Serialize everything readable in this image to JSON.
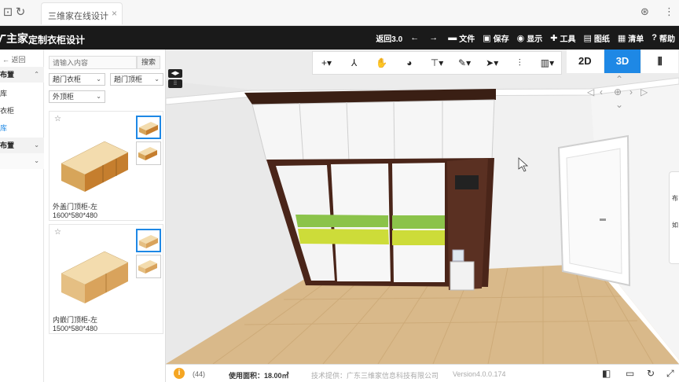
{
  "browser": {
    "tab_title": "三维家在线设计",
    "close_glyph": "×",
    "back_icon": "refresh-icon",
    "right_icons": [
      "extension-icon",
      "menu-icon"
    ]
  },
  "app": {
    "logo_text": "主家",
    "title": "定制衣柜设计",
    "menu": [
      {
        "icon": "undo-icon",
        "glyph": "",
        "label": "返回3.0"
      },
      {
        "icon": "arrow-left-icon",
        "glyph": "←",
        "label": ""
      },
      {
        "icon": "arrow-right-icon",
        "glyph": "→",
        "label": ""
      },
      {
        "icon": "folder-icon",
        "glyph": "▬",
        "label": "文件"
      },
      {
        "icon": "save-icon",
        "glyph": "▣",
        "label": "保存"
      },
      {
        "icon": "display-icon",
        "glyph": "◉",
        "label": "显示"
      },
      {
        "icon": "tools-icon",
        "glyph": "✚",
        "label": "工具"
      },
      {
        "icon": "drawings-icon",
        "glyph": "▤",
        "label": "图纸"
      },
      {
        "icon": "list-icon",
        "glyph": "▦",
        "label": "清单"
      },
      {
        "icon": "help-icon",
        "glyph": "?",
        "label": "帮助"
      }
    ]
  },
  "left_nav": {
    "back_label": "返回",
    "rows": [
      {
        "label": "布置",
        "type": "group",
        "chev": "⌃"
      },
      {
        "label": "库",
        "type": "item"
      },
      {
        "label": "衣柜",
        "type": "item"
      },
      {
        "label": "库",
        "type": "active"
      },
      {
        "label": "布置",
        "type": "group",
        "chev": "⌄"
      },
      {
        "label": "",
        "type": "group-light",
        "chev": "⌄"
      }
    ]
  },
  "catalog": {
    "search_placeholder": "请输入内容",
    "search_button": "搜索",
    "filters": [
      "趟门衣柜",
      "趟门顶柜",
      "外顶柜"
    ],
    "items": [
      {
        "name": "外盖门顶柜-左",
        "size": "1600*580*480"
      },
      {
        "name": "内嵌门顶柜-左",
        "size": "1500*580*480"
      }
    ]
  },
  "toolbar": {
    "tools": [
      {
        "name": "add-icon",
        "glyph": "+▾"
      },
      {
        "name": "pen-icon",
        "glyph": "⅄"
      },
      {
        "name": "hand-icon",
        "glyph": "✋"
      },
      {
        "name": "palette-icon",
        "glyph": "◕"
      },
      {
        "name": "paint-icon",
        "glyph": "⊤▾"
      },
      {
        "name": "measure-icon",
        "glyph": "✎▾"
      },
      {
        "name": "select-icon",
        "glyph": "➤▾"
      },
      {
        "name": "adjust-icon",
        "glyph": "⫶"
      },
      {
        "name": "view-icon",
        "glyph": "▥▾"
      }
    ],
    "modes": [
      "2D",
      "3D",
      "walk"
    ],
    "active_mode": "3D"
  },
  "status": {
    "count": "(44)",
    "area": "使用面积：18.00㎡",
    "support": "技术提供：广东三维家信息科技有限公司",
    "version": "Version4.0.0.174"
  }
}
